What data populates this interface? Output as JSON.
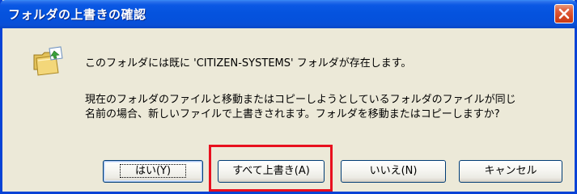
{
  "window": {
    "title": "フォルダの上書きの確認",
    "close_icon": "close-icon"
  },
  "message": {
    "line1": "このフォルダには既に 'CITIZEN-SYSTEMS' フォルダが存在します。",
    "line2": "現在のフォルダのファイルと移動またはコピーしようとしているフォルダのファイルが同じ",
    "line3": "名前の場合、新しいファイルで上書きされます。フォルダを移動またはコピーしますか?"
  },
  "icon": "folder-replace-icon",
  "buttons": {
    "yes": "はい(Y)",
    "yes_to_all": "すべて上書き(A)",
    "no": "いいえ(N)",
    "cancel": "キャンセル"
  },
  "colors": {
    "title_bar": "#0553de",
    "dialog_bg": "#ece9d8",
    "close_button": "#d4451f",
    "highlight_box": "#e8101e"
  }
}
